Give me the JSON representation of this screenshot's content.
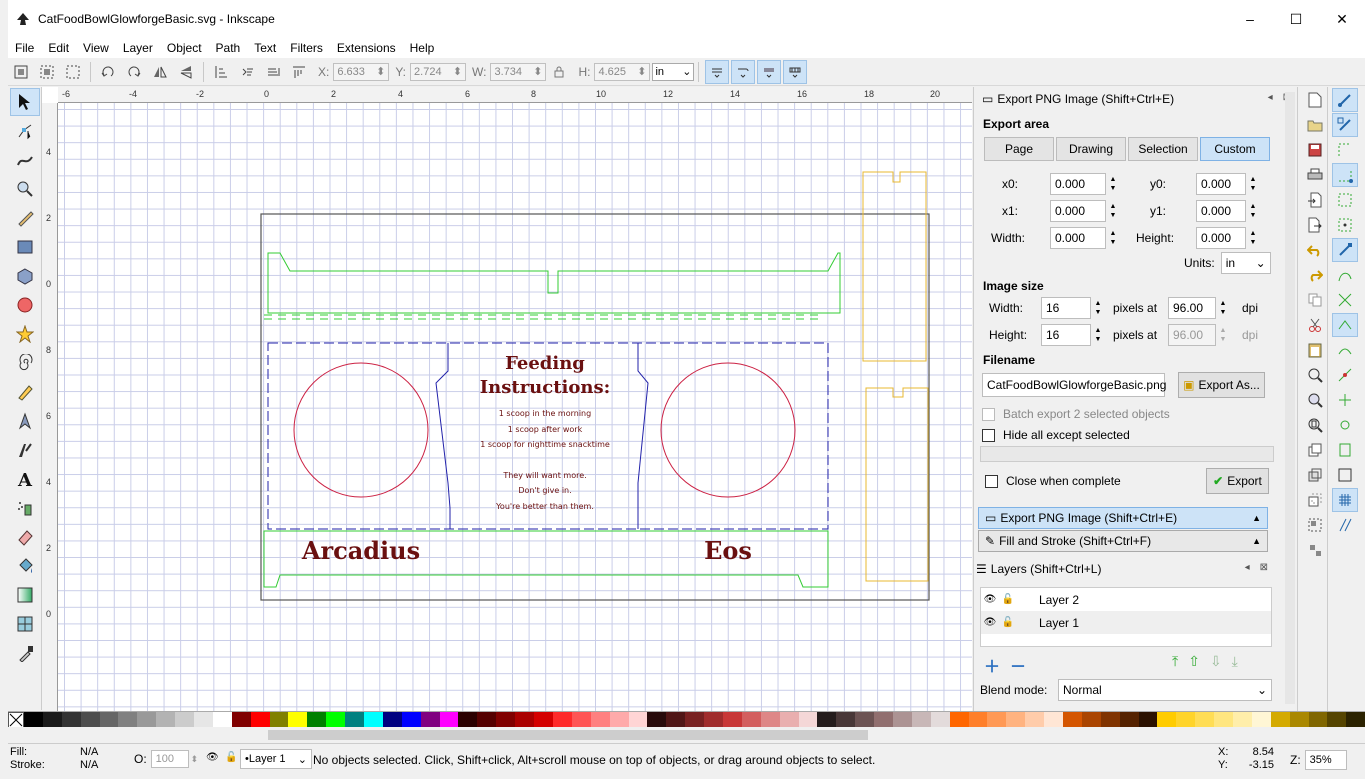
{
  "window": {
    "title": "CatFoodBowlGlowforgeBasic.svg - Inkscape",
    "min": "–",
    "max": "☐",
    "close": "✕"
  },
  "menu": [
    "File",
    "Edit",
    "View",
    "Layer",
    "Object",
    "Path",
    "Text",
    "Filters",
    "Extensions",
    "Help"
  ],
  "toolbar": {
    "x_label": "X:",
    "x": "6.633",
    "y_label": "Y:",
    "y": "2.724",
    "w_label": "W:",
    "w": "3.734",
    "h_label": "H:",
    "h": "4.625",
    "units": "in"
  },
  "ruler": {
    "h_ticks": [
      "-6",
      "-4",
      "-2",
      "0",
      "2",
      "4",
      "6",
      "8",
      "10",
      "12",
      "14",
      "16",
      "18",
      "20"
    ],
    "v_ticks": [
      "4",
      "2",
      "0",
      "8",
      "6",
      "4",
      "2",
      "0"
    ]
  },
  "artwork": {
    "title_line1": "Feeding",
    "title_line2": "Instructions:",
    "lines": [
      "1 scoop in the morning",
      "1 scoop after work",
      "1 scoop for nighttime snacktime",
      "They will want more.",
      "Don't give in.",
      "You're better than them."
    ],
    "name_left": "Arcadius",
    "name_right": "Eos",
    "colors": {
      "green": "#33cc33",
      "blue": "#2222aa",
      "red": "#cc2244",
      "orange": "#e8b830",
      "text": "#6a1010",
      "page": "#555555"
    }
  },
  "export_panel": {
    "title": "Export PNG Image (Shift+Ctrl+E)",
    "area_heading": "Export area",
    "area_buttons": [
      "Page",
      "Drawing",
      "Selection",
      "Custom"
    ],
    "x0_label": "x0:",
    "x0": "0.000",
    "y0_label": "y0:",
    "y0": "0.000",
    "x1_label": "x1:",
    "x1": "0.000",
    "y1_label": "y1:",
    "y1": "0.000",
    "width_label": "Width:",
    "width": "0.000",
    "height_label": "Height:",
    "height": "0.000",
    "units_label": "Units:",
    "units": "in",
    "size_heading": "Image size",
    "img_width_label": "Width:",
    "img_width": "16",
    "img_height_label": "Height:",
    "img_height": "16",
    "pixels_at": "pixels at",
    "dpi_value": "96.00",
    "dpi_value2": "96.00",
    "dpi": "dpi",
    "filename_heading": "Filename",
    "filename": "CatFoodBowlGlowforgeBasic.png",
    "export_as": "Export As...",
    "batch": "Batch export 2 selected objects",
    "hide_all": "Hide all except selected",
    "close_when_complete": "Close when complete",
    "export": "Export"
  },
  "dock_items": [
    "Export PNG Image (Shift+Ctrl+E)",
    "Fill and Stroke (Shift+Ctrl+F)"
  ],
  "layers_panel": {
    "title": "Layers (Shift+Ctrl+L)",
    "layers": [
      "Layer 2",
      "Layer 1"
    ],
    "blend_label": "Blend mode:",
    "blend": "Normal"
  },
  "status": {
    "fill_label": "Fill:",
    "fill": "N/A",
    "stroke_label": "Stroke:",
    "stroke": "N/A",
    "opacity_label": "O:",
    "opacity": "100",
    "layer": "•Layer 1",
    "message": "No objects selected. Click, Shift+click, Alt+scroll mouse on top of objects, or drag around objects to select.",
    "x_label": "X:",
    "x": "8.54",
    "y_label": "Y:",
    "y": "-3.15",
    "zoom_label": "Z:",
    "zoom": "35%"
  },
  "palette": [
    "#000000",
    "#1a1a1a",
    "#333333",
    "#4d4d4d",
    "#666666",
    "#808080",
    "#999999",
    "#b3b3b3",
    "#cccccc",
    "#e6e6e6",
    "#ffffff",
    "#800000",
    "#ff0000",
    "#808000",
    "#ffff00",
    "#008000",
    "#00ff00",
    "#008080",
    "#00ffff",
    "#000080",
    "#0000ff",
    "#800080",
    "#ff00ff",
    "#2b0000",
    "#550000",
    "#800000",
    "#aa0000",
    "#d40000",
    "#ff2a2a",
    "#ff5555",
    "#ff8080",
    "#ffaaaa",
    "#ffd5d5",
    "#280b0b",
    "#501616",
    "#782121",
    "#a02c2c",
    "#c83737",
    "#d35f5f",
    "#de8787",
    "#e9afaf",
    "#f4d7d7",
    "#241c1c",
    "#483737",
    "#6c5353",
    "#916f6f",
    "#ac9393",
    "#c8b7b7",
    "#e3dbdb",
    "#ff6600",
    "#ff7f2a",
    "#ff9955",
    "#ffb380",
    "#ffccaa",
    "#ffe6d5",
    "#d45500",
    "#aa4400",
    "#803300",
    "#552200",
    "#2b1100",
    "#ffcc00",
    "#ffd42a",
    "#ffdd55",
    "#ffe680",
    "#ffeeaa",
    "#fff6d5",
    "#d4aa00",
    "#aa8800",
    "#806600",
    "#554400",
    "#2b2200"
  ]
}
